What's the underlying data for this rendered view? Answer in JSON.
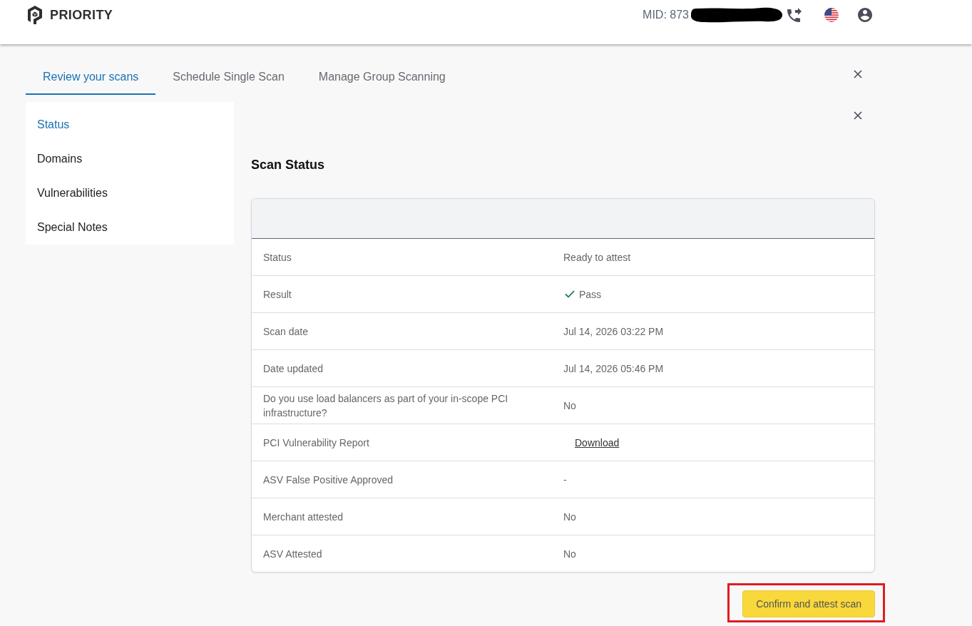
{
  "header": {
    "brand": "PRIORITY",
    "merchant_id": {
      "text": "MID: 873",
      "redacted": true
    }
  },
  "tabs": [
    {
      "label": "Review your scans",
      "selected": true
    },
    {
      "label": "Schedule Single Scan",
      "selected": false
    },
    {
      "label": "Manage Group Scanning",
      "selected": false
    }
  ],
  "sidebar": {
    "items": [
      {
        "label": "Status",
        "selected": true
      },
      {
        "label": "Domains",
        "selected": false
      },
      {
        "label": "Vulnerabilities",
        "selected": false
      },
      {
        "label": "Special Notes",
        "selected": false
      }
    ]
  },
  "section": {
    "title": "Scan Status"
  },
  "table": {
    "rows": [
      {
        "label": "Status",
        "value": "Ready to attest",
        "kind": "text"
      },
      {
        "label": "Result",
        "value": "Pass",
        "kind": "check"
      },
      {
        "label": "Scan date",
        "value": "Jul 14, 2026 03:22 PM",
        "kind": "text"
      },
      {
        "label": "Date updated",
        "value": "Jul 14, 2026 05:46 PM",
        "kind": "text"
      },
      {
        "label": "Do you use load balancers as part of your in-scope PCI infrastructure?",
        "value": "No",
        "kind": "text"
      },
      {
        "label": "PCI Vulnerability Report",
        "value": "Download",
        "kind": "link"
      },
      {
        "label": "ASV False Positive Approved",
        "value": "-",
        "kind": "text"
      },
      {
        "label": "Merchant attested",
        "value": "No",
        "kind": "text"
      },
      {
        "label": "ASV Attested",
        "value": "No",
        "kind": "text"
      }
    ]
  },
  "action": {
    "label": "Confirm and attest scan",
    "highlighted": true
  }
}
